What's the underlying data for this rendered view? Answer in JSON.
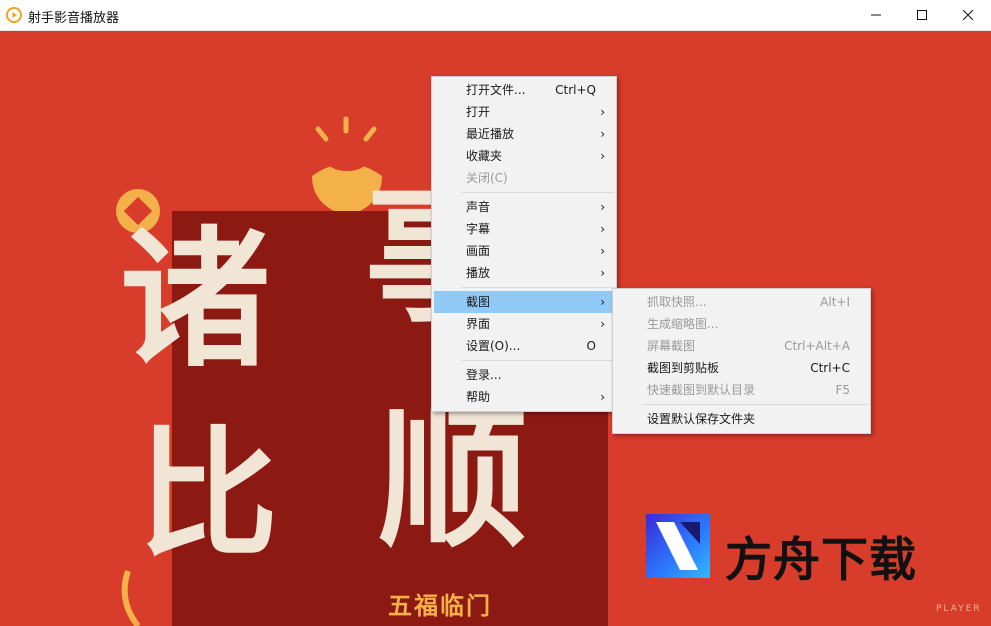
{
  "window": {
    "title": "射手影音播放器"
  },
  "colors": {
    "accent_highlight": "#91c9f7",
    "video_bg": "#d83c2b",
    "poster_bg": "#8c1a12"
  },
  "video": {
    "poster_chars": [
      "诸",
      "事",
      "比",
      "顺"
    ],
    "poster_caption": "五福临门",
    "watermark_text": "方舟下载",
    "player_mark": "PLAYER"
  },
  "context_menu": {
    "items": [
      {
        "label": "打开文件...",
        "shortcut": "Ctrl+Q",
        "submenu": false,
        "disabled": false
      },
      {
        "label": "打开",
        "shortcut": "",
        "submenu": true,
        "disabled": false
      },
      {
        "label": "最近播放",
        "shortcut": "",
        "submenu": true,
        "disabled": false
      },
      {
        "label": "收藏夹",
        "shortcut": "",
        "submenu": true,
        "disabled": false
      },
      {
        "label": "关闭(C)",
        "shortcut": "",
        "submenu": false,
        "disabled": true
      },
      {
        "label": "声音",
        "shortcut": "",
        "submenu": true,
        "disabled": false
      },
      {
        "label": "字幕",
        "shortcut": "",
        "submenu": true,
        "disabled": false
      },
      {
        "label": "画面",
        "shortcut": "",
        "submenu": true,
        "disabled": false
      },
      {
        "label": "播放",
        "shortcut": "",
        "submenu": true,
        "disabled": false
      },
      {
        "label": "截图",
        "shortcut": "",
        "submenu": true,
        "disabled": false,
        "highlighted": true
      },
      {
        "label": "界面",
        "shortcut": "",
        "submenu": true,
        "disabled": false
      },
      {
        "label": "设置(O)...",
        "shortcut": "O",
        "submenu": false,
        "disabled": false
      },
      {
        "label": "登录...",
        "shortcut": "",
        "submenu": false,
        "disabled": false
      },
      {
        "label": "帮助",
        "shortcut": "",
        "submenu": true,
        "disabled": false
      }
    ],
    "arrow_glyph": "›"
  },
  "screenshot_submenu": {
    "items": [
      {
        "label": "抓取快照...",
        "shortcut": "Alt+I",
        "disabled": true
      },
      {
        "label": "生成缩略图...",
        "shortcut": "",
        "disabled": true
      },
      {
        "label": "屏幕截图",
        "shortcut": "Ctrl+Alt+A",
        "disabled": true
      },
      {
        "label": "截图到剪贴板",
        "shortcut": "Ctrl+C",
        "disabled": false
      },
      {
        "label": "快速截图到默认目录",
        "shortcut": "F5",
        "disabled": true
      },
      {
        "label": "设置默认保存文件夹",
        "shortcut": "",
        "disabled": false
      }
    ]
  }
}
